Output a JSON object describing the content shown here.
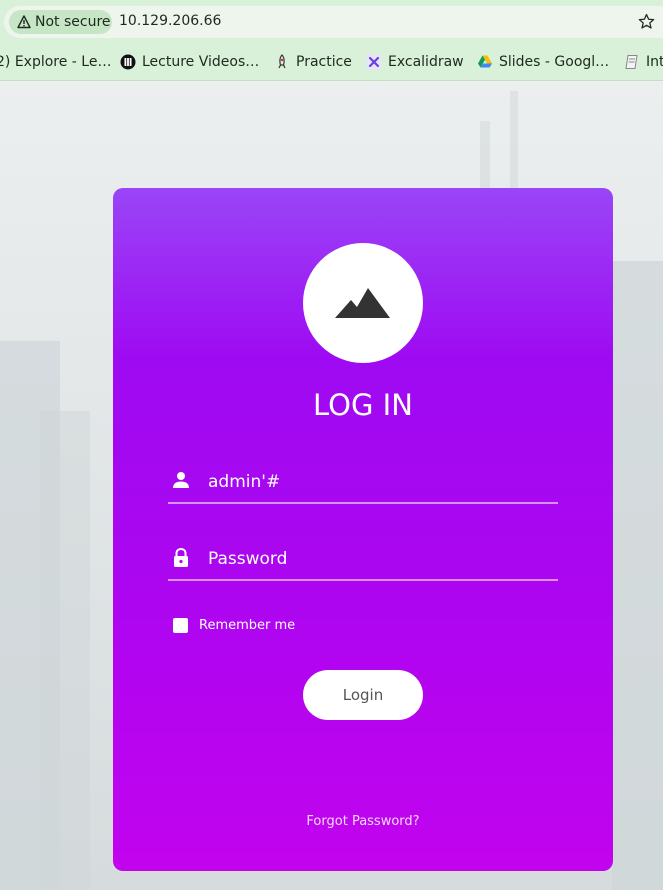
{
  "browser": {
    "security_label": "Not secure",
    "url": "10.129.206.66"
  },
  "bookmarks": [
    {
      "label": "2) Explore - Le…",
      "icon": "explore-icon"
    },
    {
      "label": "Lecture Videos…",
      "icon": "lecture-videos-icon"
    },
    {
      "label": "Practice",
      "icon": "rocket-icon"
    },
    {
      "label": "Excalidraw",
      "icon": "excalidraw-icon"
    },
    {
      "label": "Slides - Googl…",
      "icon": "google-drive-icon"
    },
    {
      "label": "Int",
      "icon": "notebook-icon"
    }
  ],
  "login": {
    "title": "LOG IN",
    "username_value": "admin'#",
    "password_placeholder": "Password",
    "remember_label": "Remember me",
    "login_button": "Login",
    "forgot_link": "Forgot Password?"
  },
  "colors": {
    "card_gradient_top": "#9a45f7",
    "card_gradient_bottom": "#c203ee",
    "chrome_green": "#d9f0d9"
  }
}
